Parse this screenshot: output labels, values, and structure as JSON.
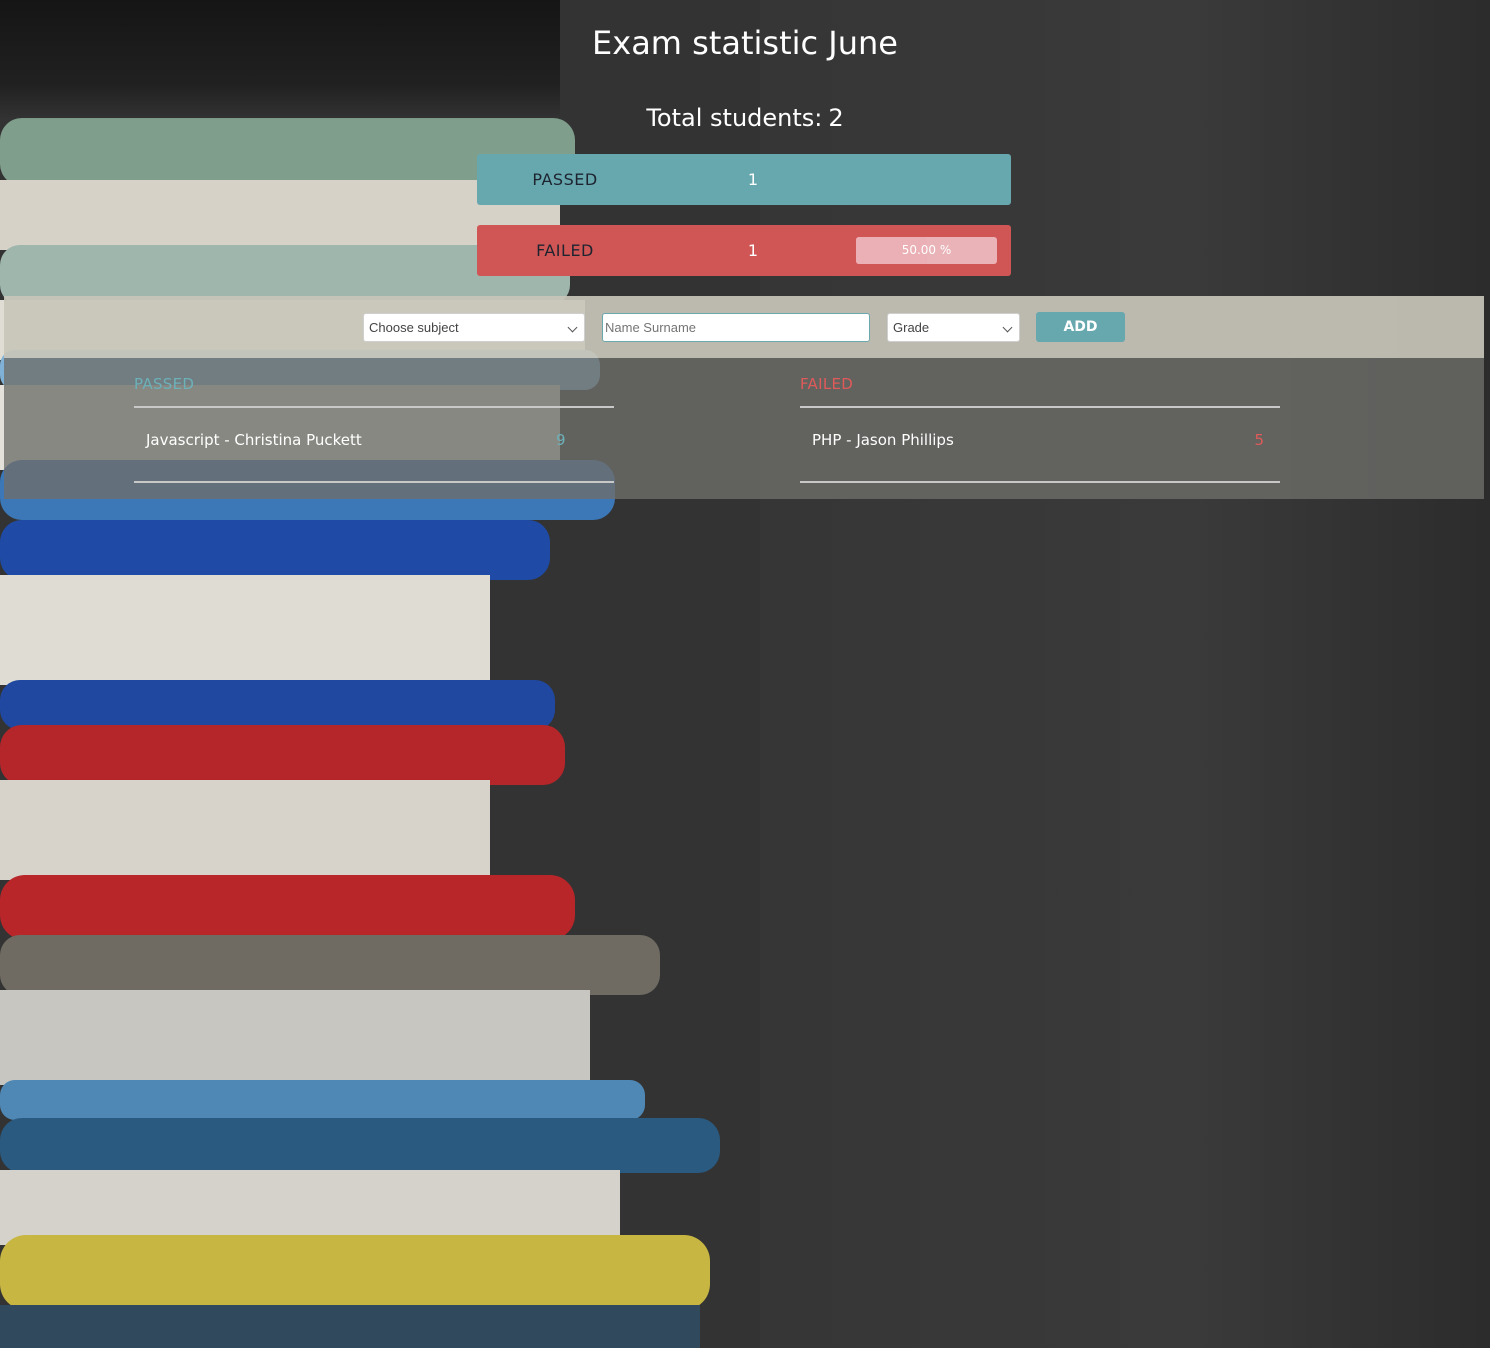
{
  "page": {
    "title": "Exam statistic June",
    "total_label": "Total students:",
    "total_value": "2"
  },
  "stats": {
    "passed": {
      "label": "PASSED",
      "count": "1",
      "color": "#67a7ae"
    },
    "failed": {
      "label": "FAILED",
      "count": "1",
      "color": "#d05656",
      "percent_text": "50.00 %",
      "percent_value": 50
    }
  },
  "form": {
    "subject_placeholder": "Choose subject",
    "name_placeholder": "Name Surname",
    "grade_placeholder": "Grade",
    "add_label": "ADD"
  },
  "results": {
    "passed": {
      "heading": "PASSED",
      "rows": [
        {
          "text": "Javascript - Christina Puckett",
          "grade": "9"
        }
      ]
    },
    "failed": {
      "heading": "FAILED",
      "rows": [
        {
          "text": "PHP - Jason Phillips",
          "grade": "5"
        }
      ]
    }
  }
}
